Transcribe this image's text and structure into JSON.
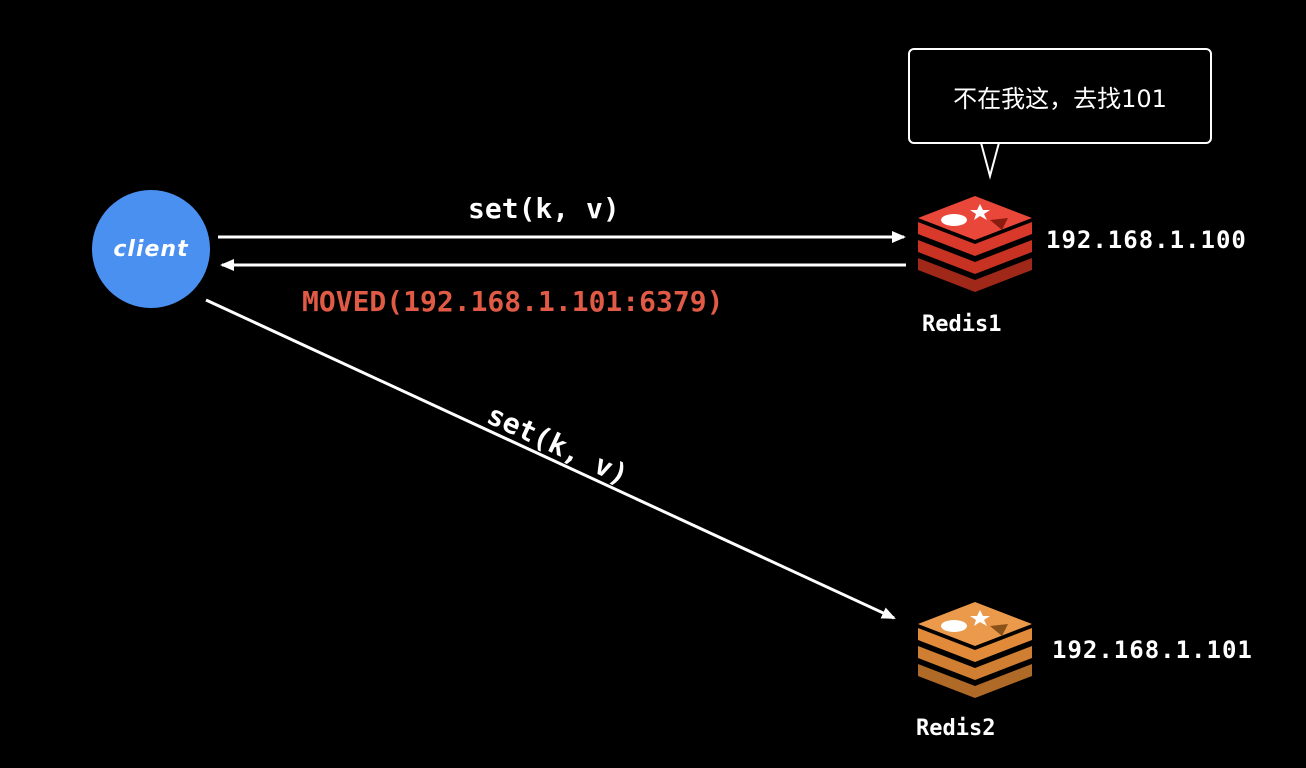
{
  "client": {
    "label": "client"
  },
  "redis1": {
    "name": "Redis1",
    "ip": "192.168.1.100",
    "color": "#d8392b",
    "bubble_text": "不在我这，去找101"
  },
  "redis2": {
    "name": "Redis2",
    "ip": "192.168.1.101",
    "color": "#e08a3a"
  },
  "arrows": {
    "request1": "set(k,  v)",
    "response1": "MOVED(192.168.1.101:6379)",
    "request2": "set(k,  v)"
  },
  "colors": {
    "background": "#000000",
    "client": "#4a90f0",
    "moved": "#e05a45"
  }
}
